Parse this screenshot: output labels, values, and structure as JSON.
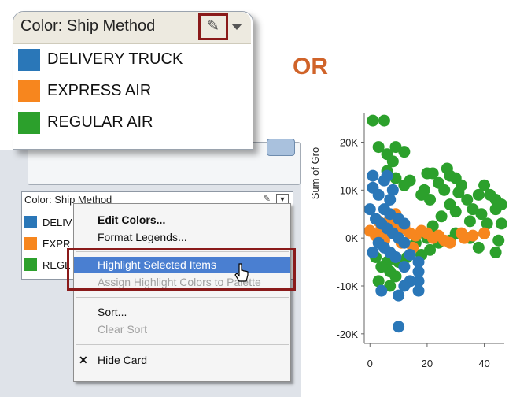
{
  "or_label": "OR",
  "big_legend": {
    "title": "Color: Ship Method",
    "items": [
      {
        "label": "DELIVERY TRUCK",
        "color": "#2a77b8"
      },
      {
        "label": "EXPRESS AIR",
        "color": "#f7861e"
      },
      {
        "label": "REGULAR AIR",
        "color": "#2ca02c"
      }
    ],
    "edit_icon": "pencil-icon",
    "dropdown_icon": "chevron-down-icon"
  },
  "small_card": {
    "title": "Color: Ship Method",
    "items": [
      {
        "label": "DELIV",
        "color": "#2a77b8"
      },
      {
        "label": "EXPR",
        "color": "#f7861e"
      },
      {
        "label": "REGL",
        "color": "#2ca02c"
      }
    ]
  },
  "menu": {
    "edit_colors": "Edit Colors...",
    "format_legends": "Format Legends...",
    "highlight_selected": "Highlight Selected Items",
    "assign_highlight": "Assign Highlight Colors to Palette",
    "sort": "Sort...",
    "clear_sort": "Clear Sort",
    "hide_card": "Hide Card",
    "hide_icon": "✕"
  },
  "chart_data": {
    "type": "scatter",
    "ylabel": "Sum of Gro",
    "y_ticks": [
      "20K",
      "10K",
      "0K",
      "-10K",
      "-20K"
    ],
    "x_ticks": [
      "0",
      "20",
      "40"
    ],
    "xlim": [
      -2,
      47
    ],
    "ylim": [
      -22000,
      26000
    ],
    "series": [
      {
        "color": "#2ca02c",
        "points": [
          [
            1,
            24500
          ],
          [
            5,
            24500
          ],
          [
            3,
            19000
          ],
          [
            6,
            17500
          ],
          [
            8,
            16000
          ],
          [
            9,
            19000
          ],
          [
            12,
            18000
          ],
          [
            6,
            14000
          ],
          [
            9,
            12500
          ],
          [
            14,
            12000
          ],
          [
            12,
            11000
          ],
          [
            20,
            13500
          ],
          [
            22,
            13500
          ],
          [
            27,
            14500
          ],
          [
            28,
            13000
          ],
          [
            30,
            12500
          ],
          [
            19,
            10000
          ],
          [
            24,
            11500
          ],
          [
            26,
            10000
          ],
          [
            32,
            11000
          ],
          [
            18,
            9000
          ],
          [
            21,
            8000
          ],
          [
            28,
            7000
          ],
          [
            31,
            9500
          ],
          [
            34,
            8000
          ],
          [
            38,
            9000
          ],
          [
            40,
            11000
          ],
          [
            42,
            9000
          ],
          [
            44,
            8000
          ],
          [
            36,
            6000
          ],
          [
            39,
            5000
          ],
          [
            44,
            6000
          ],
          [
            46,
            7000
          ],
          [
            30,
            5500
          ],
          [
            25,
            4500
          ],
          [
            35,
            3500
          ],
          [
            41,
            3000
          ],
          [
            46,
            3000
          ],
          [
            22,
            2500
          ],
          [
            30,
            1000
          ],
          [
            35,
            0
          ],
          [
            28,
            -500
          ],
          [
            24,
            -1000
          ],
          [
            40,
            1000
          ],
          [
            45,
            -500
          ],
          [
            16,
            -1000
          ],
          [
            20,
            0
          ],
          [
            18,
            -3500
          ],
          [
            21,
            -2500
          ],
          [
            13,
            -4000
          ],
          [
            10,
            -5000
          ],
          [
            7,
            -7000
          ],
          [
            9,
            -8000
          ],
          [
            6,
            -5000
          ],
          [
            4,
            -6000
          ],
          [
            2,
            -4000
          ],
          [
            3,
            -9000
          ],
          [
            7,
            -10000
          ],
          [
            44,
            -3000
          ],
          [
            38,
            -2000
          ]
        ]
      },
      {
        "color": "#f7861e",
        "points": [
          [
            0,
            1500
          ],
          [
            2,
            500
          ],
          [
            4,
            2000
          ],
          [
            6,
            1000
          ],
          [
            8,
            3000
          ],
          [
            10,
            1500
          ],
          [
            12,
            2500
          ],
          [
            14,
            1000
          ],
          [
            16,
            500
          ],
          [
            18,
            1500
          ],
          [
            20,
            1000
          ],
          [
            22,
            0
          ],
          [
            24,
            500
          ],
          [
            26,
            -500
          ],
          [
            32,
            1000
          ],
          [
            36,
            500
          ],
          [
            40,
            1000
          ],
          [
            5,
            -500
          ],
          [
            7,
            4000
          ],
          [
            9,
            5000
          ],
          [
            3,
            3500
          ],
          [
            11,
            -1000
          ],
          [
            15,
            -2000
          ],
          [
            28,
            -1000
          ],
          [
            33,
            0
          ]
        ]
      },
      {
        "color": "#2a77b8",
        "points": [
          [
            1,
            13000
          ],
          [
            1,
            10500
          ],
          [
            3,
            9000
          ],
          [
            5,
            12000
          ],
          [
            6,
            13000
          ],
          [
            7,
            8000
          ],
          [
            8,
            10000
          ],
          [
            5,
            6000
          ],
          [
            7,
            5000
          ],
          [
            10,
            4000
          ],
          [
            12,
            3000
          ],
          [
            0,
            6000
          ],
          [
            2,
            4000
          ],
          [
            4,
            3000
          ],
          [
            6,
            2000
          ],
          [
            8,
            1000
          ],
          [
            10,
            0
          ],
          [
            12,
            -1000
          ],
          [
            3,
            -1000
          ],
          [
            5,
            -2000
          ],
          [
            1,
            -3000
          ],
          [
            7,
            -3000
          ],
          [
            9,
            -4000
          ],
          [
            12,
            -6000
          ],
          [
            14,
            -3500
          ],
          [
            17,
            -5000
          ],
          [
            17,
            -7000
          ],
          [
            17,
            -9000
          ],
          [
            17,
            -11000
          ],
          [
            14,
            -9000
          ],
          [
            12,
            -10000
          ],
          [
            10,
            -12000
          ],
          [
            4,
            -11000
          ],
          [
            10,
            -18500
          ]
        ]
      }
    ]
  }
}
